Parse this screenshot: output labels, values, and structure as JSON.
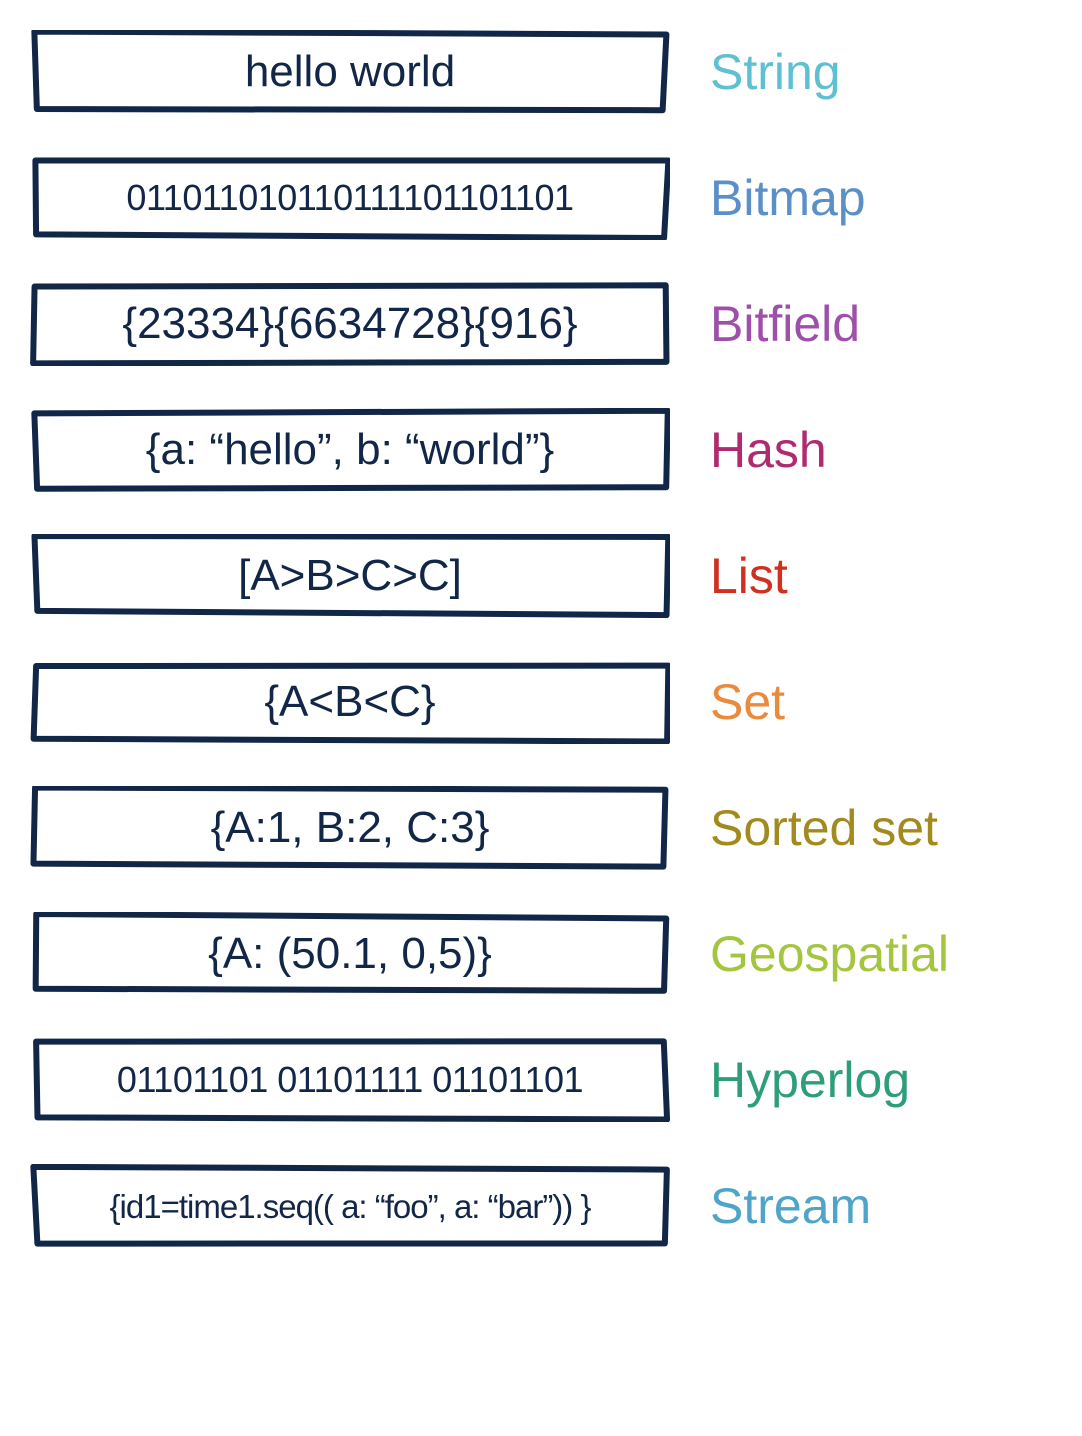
{
  "rows": [
    {
      "content": "hello world",
      "label": "String",
      "color": "#5fc0d3"
    },
    {
      "content": "011011010110111101101101",
      "label": "Bitmap",
      "color": "#5a8fc7"
    },
    {
      "content": "{23334}{6634728}{916}",
      "label": "Bitfield",
      "color": "#9e4fa9"
    },
    {
      "content": "{a: “hello”, b: “world”}",
      "label": "Hash",
      "color": "#b02a6f"
    },
    {
      "content": "[A>B>C>C]",
      "label": "List",
      "color": "#d0301f"
    },
    {
      "content": "{A<B<C}",
      "label": "Set",
      "color": "#e98a3c"
    },
    {
      "content": "{A:1, B:2, C:3}",
      "label": "Sorted set",
      "color": "#a38a1e"
    },
    {
      "content": "{A: (50.1, 0,5)}",
      "label": "Geospatial",
      "color": "#a4c63f"
    },
    {
      "content": "01101101 01101111 01101101",
      "label": "Hyperlog",
      "color": "#2e9e7a"
    },
    {
      "content": "{id1=time1.seq(( a: “foo”, a: “bar”)) }",
      "label": "Stream",
      "color": "#4fa5c9"
    }
  ],
  "longRows": [
    1,
    8
  ],
  "verylongRows": [
    9
  ]
}
